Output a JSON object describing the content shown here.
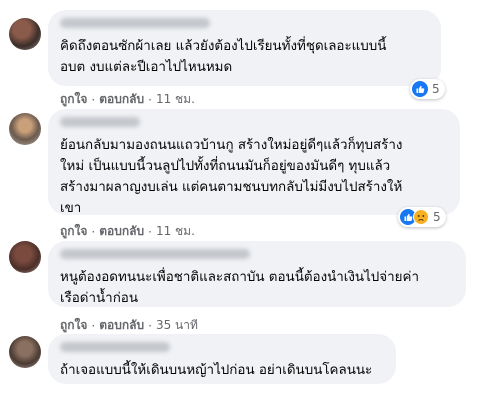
{
  "comments": [
    {
      "text": "คิดถึงตอนซักผ้าเลย แล้วยังต้องไปเรียนทั้งที่ชุดเลอะแบบนี้\nอบต งบแต่ละปีเอาไปไหนหมด",
      "like_label": "ถูกใจ",
      "reply_label": "ตอบกลับ",
      "time": "11 ชม.",
      "reaction_count": "5",
      "reactions": [
        "like"
      ]
    },
    {
      "text": "ย้อนกลับมามองถนนแถวบ้านกู สร้างใหม่อยู่ดีๆแล้วก็ทุบสร้าง\nใหม่ เป็นแบบนี้วนลูปไปทั้งที่ถนนมันก็อยู่ของมันดีๆ ทุบแล้ว\nสร้างมาผลาญงบเล่น แต่คนตามชนบทกลับไม่มีงบไปสร้างให้\nเขา",
      "like_label": "ถูกใจ",
      "reply_label": "ตอบกลับ",
      "time": "11 ชม.",
      "reaction_count": "5",
      "reactions": [
        "like",
        "sad"
      ]
    },
    {
      "text": "หนูต้องอดทนนะเพื่อชาติและสถาบัน ตอนนี้ต้องนำเงินไปจ่ายค่า\nเรือด่าน้ำก่อน",
      "like_label": "ถูกใจ",
      "reply_label": "ตอบกลับ",
      "time": "35 นาที"
    },
    {
      "text": "ถ้าเจอแบบนี้ให้เดินบนหญ้าไปก่อน อย่าเดินบนโคลนนะ"
    }
  ],
  "separator": "·",
  "colors": {
    "bubble_bg": "#f0f2f5",
    "meta_text": "#65676b",
    "like_blue": "#1877f2",
    "sad_yellow": "#f7b125"
  }
}
